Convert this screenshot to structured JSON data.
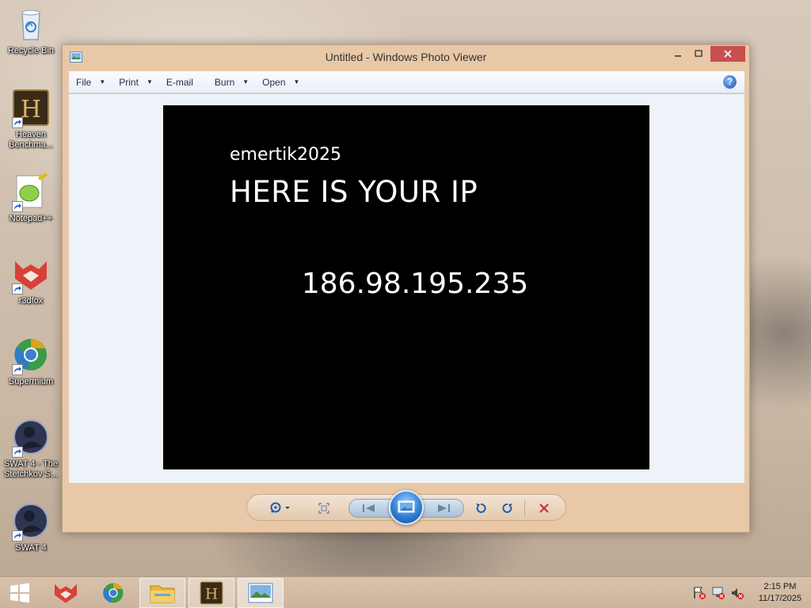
{
  "desktop_icons": [
    {
      "label": "Recycle Bin",
      "icon": "recycle-bin-icon"
    },
    {
      "label": "Heaven Benchma...",
      "icon": "heaven-benchmark-icon"
    },
    {
      "label": "Notepad++",
      "icon": "notepad-plus-plus-icon"
    },
    {
      "label": "r3dfox",
      "icon": "r3dfox-icon"
    },
    {
      "label": "Supermium",
      "icon": "supermium-icon"
    },
    {
      "label": "SWAT 4 - The Stetchkov S...",
      "icon": "swat4-icon"
    },
    {
      "label": "SWAT 4",
      "icon": "swat4-icon"
    }
  ],
  "window": {
    "title": "Untitled - Windows Photo Viewer",
    "menu": {
      "file": "File",
      "print": "Print",
      "email": "E-mail",
      "burn": "Burn",
      "open": "Open"
    },
    "help": "?",
    "photo": {
      "username": "emertik2025",
      "headline": "HERE IS YOUR IP",
      "ip": "186.98.195.235"
    }
  },
  "taskbar": {
    "clock_time": "2:15 PM",
    "clock_date": "11/17/2025"
  },
  "colors": {
    "close_button": "#c7504f",
    "menu_text": "#1e2d4a",
    "photo_bg": "#000000"
  }
}
